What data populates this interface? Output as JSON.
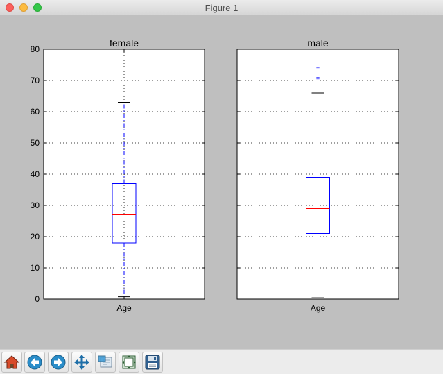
{
  "window": {
    "title": "Figure 1"
  },
  "colors": {
    "box": "#0000ff",
    "median": "#ff0000",
    "whisker": "#0000ff",
    "background": "#bfbfbf",
    "axes": "#ffffff"
  },
  "chart_data": [
    {
      "type": "box",
      "title": "female",
      "categories": [
        "Age"
      ],
      "xlabel": "",
      "ylabel": "",
      "ylim": [
        0,
        80
      ],
      "yticks": [
        0,
        10,
        20,
        30,
        40,
        50,
        60,
        70,
        80
      ],
      "grid": true,
      "box": {
        "whisker_low": 0.75,
        "q1": 18,
        "median": 27,
        "q3": 37,
        "whisker_high": 63
      },
      "outliers": []
    },
    {
      "type": "box",
      "title": "male",
      "categories": [
        "Age"
      ],
      "xlabel": "",
      "ylabel": "",
      "ylim": [
        0,
        80
      ],
      "yticks": [
        0,
        10,
        20,
        30,
        40,
        50,
        60,
        70,
        80
      ],
      "grid": true,
      "box": {
        "whisker_low": 0.42,
        "q1": 21,
        "median": 29,
        "q3": 39,
        "whisker_high": 66
      },
      "outliers": [
        70.5,
        71,
        74,
        80
      ]
    }
  ],
  "toolbar": {
    "buttons": [
      {
        "name": "home-button",
        "icon": "home-icon"
      },
      {
        "name": "back-button",
        "icon": "back-arrow-icon"
      },
      {
        "name": "forward-button",
        "icon": "forward-arrow-icon"
      },
      {
        "name": "pan-button",
        "icon": "move-arrows-icon"
      },
      {
        "name": "zoom-button",
        "icon": "zoom-rect-icon"
      },
      {
        "name": "subplots-button",
        "icon": "subplots-icon"
      },
      {
        "name": "save-button",
        "icon": "floppy-disk-icon"
      }
    ]
  }
}
